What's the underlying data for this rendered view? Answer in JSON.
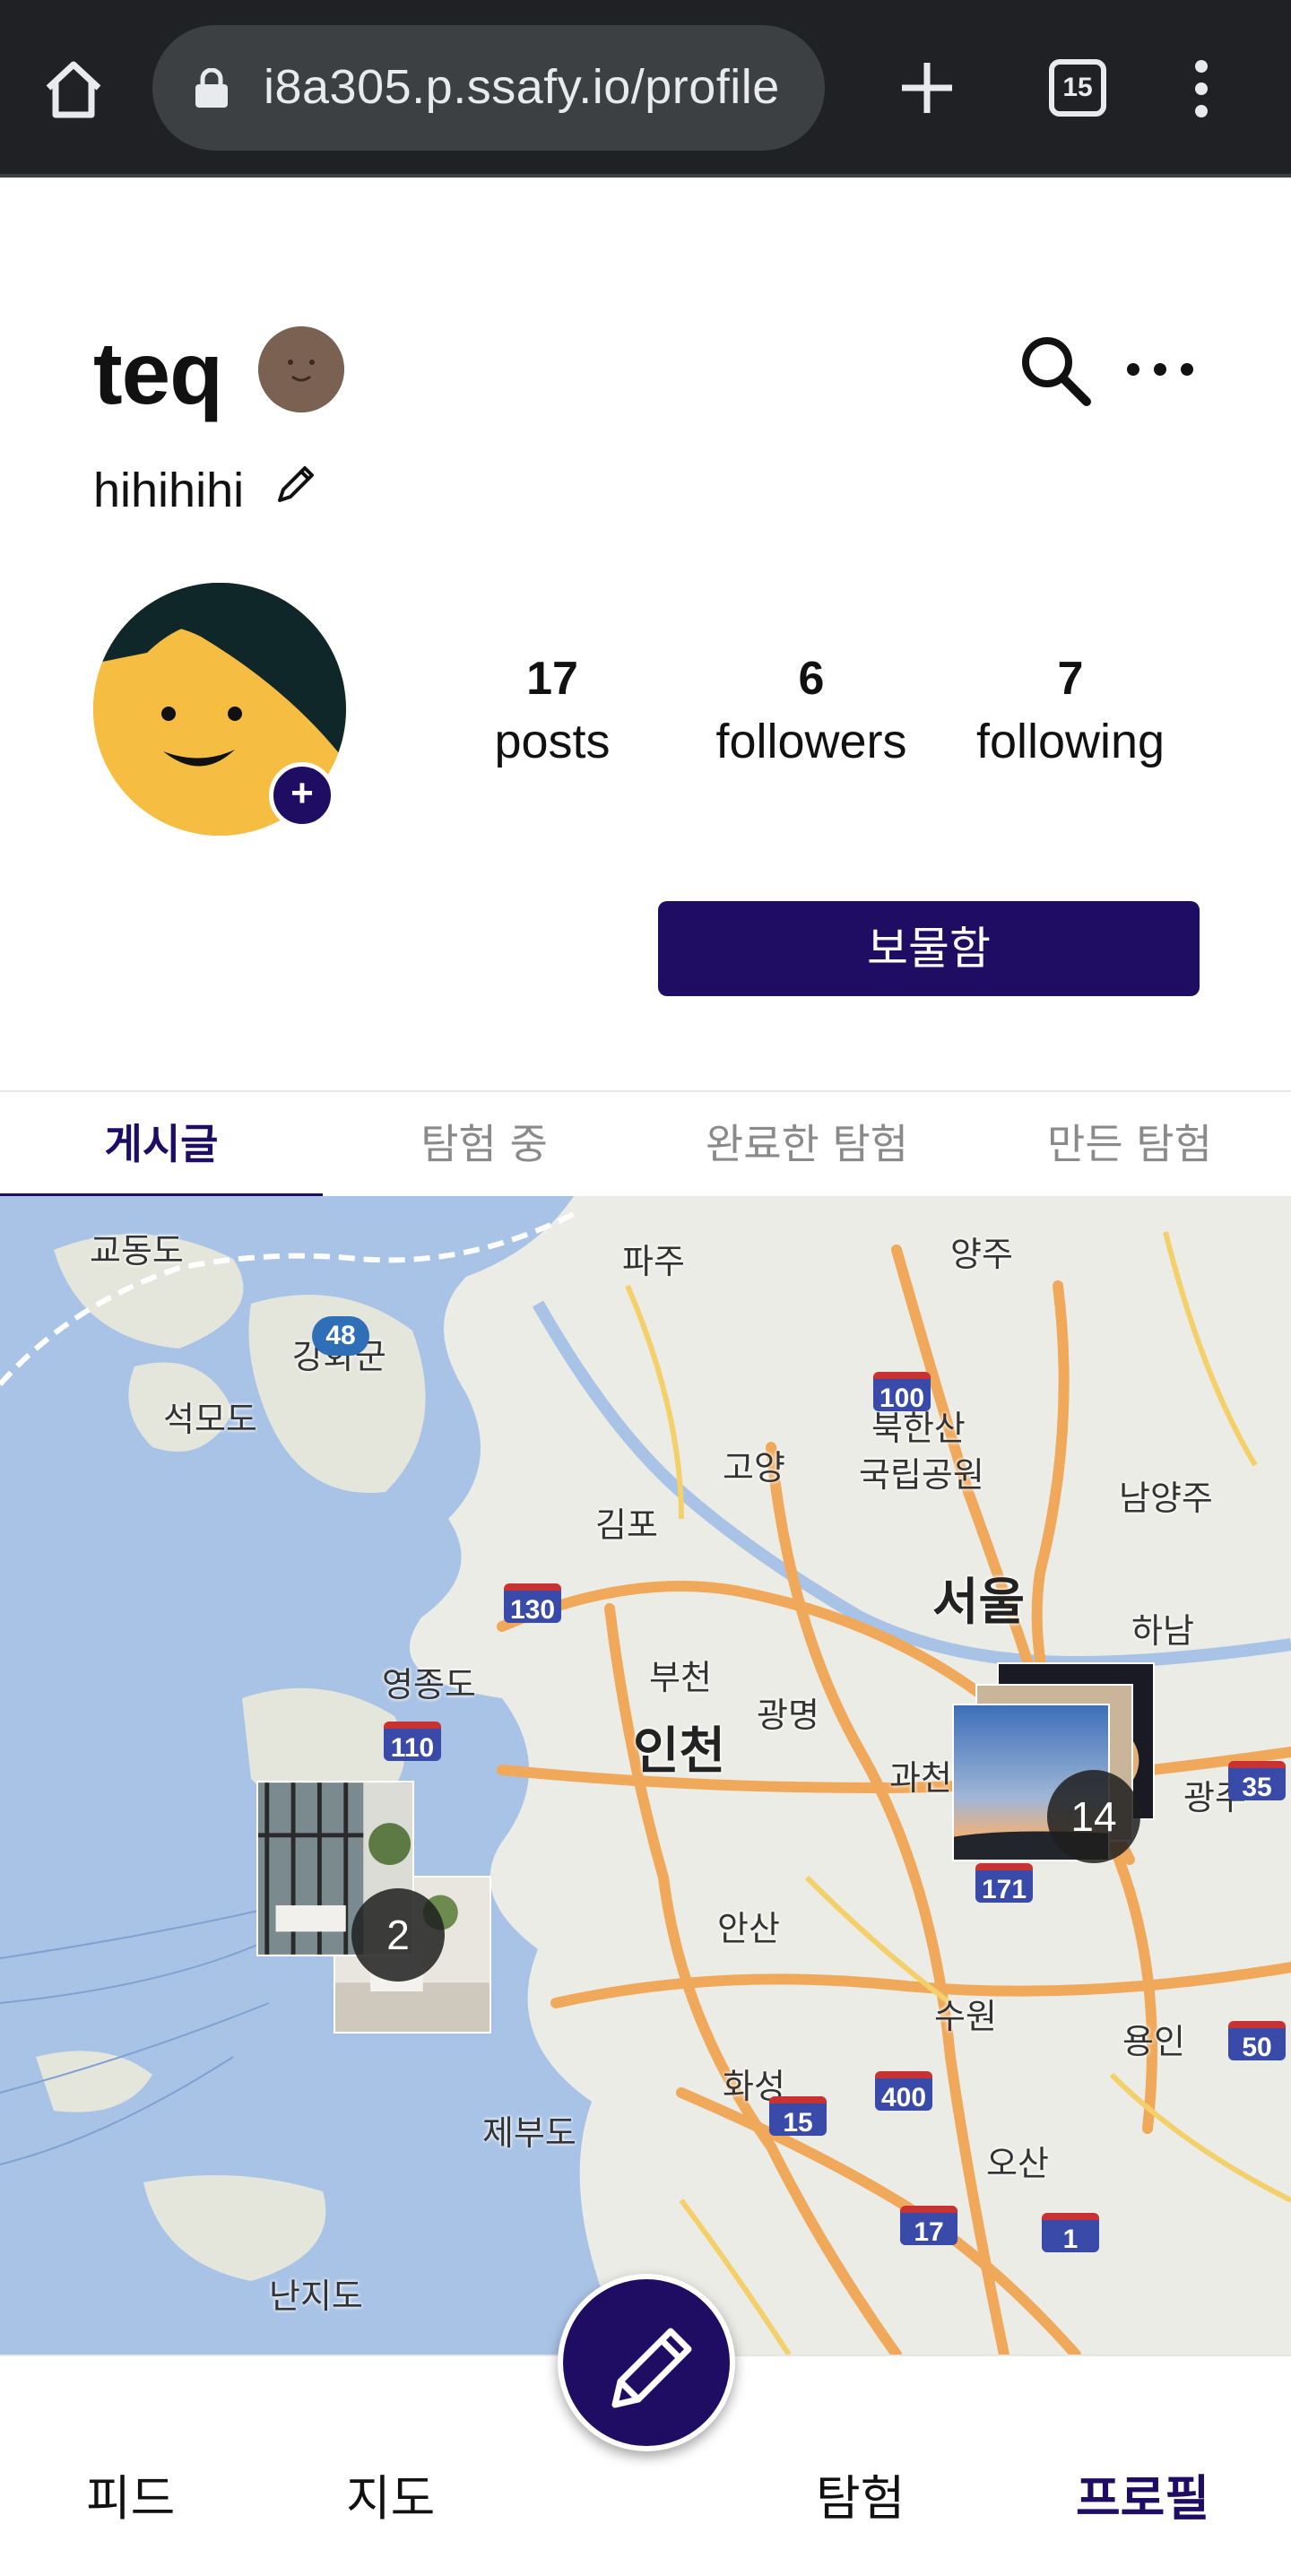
{
  "browser": {
    "url": "i8a305.p.ssafy.io/profile",
    "tab_count": "15"
  },
  "profile": {
    "username": "teq",
    "bio": "hihihihi",
    "stats": [
      {
        "value": "17",
        "label": "posts"
      },
      {
        "value": "6",
        "label": "followers"
      },
      {
        "value": "7",
        "label": "following"
      }
    ],
    "treasure_button": "보물함",
    "avatar_add": "+"
  },
  "tabs": [
    "게시글",
    "탐험 중",
    "완료한 탐험",
    "만든 탐험"
  ],
  "active_tab": 0,
  "map": {
    "places": {
      "gyodongdo": "교동도",
      "paju": "파주",
      "yangju": "양주",
      "ganghwa": "강화군",
      "seongmodo": "석모도",
      "bukhansan": "북한산",
      "national_park": "국립공원",
      "goyang": "고양",
      "gimpo": "김포",
      "namyangju": "남양주",
      "seoul": "서울",
      "hanam": "하남",
      "yeongjongdo": "영종도",
      "bucheon": "부천",
      "gwangmyeong": "광명",
      "incheon": "인천",
      "gwacheon": "과천",
      "gwangju": "광주",
      "ansan": "안산",
      "suwon": "수원",
      "yongin": "용인",
      "hwaseong": "화성",
      "jebudo": "제부도",
      "osan": "오산",
      "nanjido": "난지도"
    },
    "routes": [
      "48",
      "100",
      "130",
      "110",
      "171",
      "400",
      "15",
      "17",
      "1",
      "35",
      "50"
    ],
    "clusters": [
      {
        "count": "2"
      },
      {
        "count": "14"
      }
    ]
  },
  "bottom_nav": {
    "feed": "피드",
    "map": "지도",
    "explore": "탐험",
    "profile": "프로필"
  },
  "colors": {
    "brand": "#1f0c63",
    "water": "#a9c3e6",
    "road": "#f0a85a"
  }
}
